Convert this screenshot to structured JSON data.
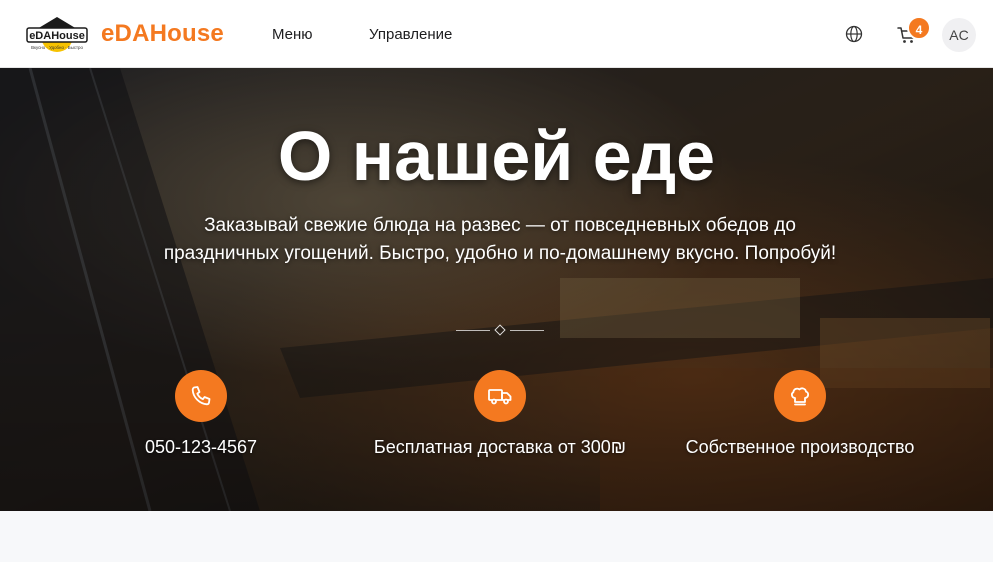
{
  "header": {
    "brand": "eDAHouse",
    "logo_text": "eDAHouse",
    "logo_tagline": "Вкусно · Удобно · Быстро",
    "nav": [
      {
        "label": "Меню"
      },
      {
        "label": "Управление"
      }
    ],
    "language_icon": "globe-icon",
    "cart_icon": "cart-icon",
    "cart_count": "4",
    "avatar_initials": "AC"
  },
  "hero": {
    "title": "О нашей еде",
    "subtitle": "Заказывай свежие блюда на развес — от повседневных обедов до праздничных угощений. Быстро, удобно и по-домашнему вкусно. Попробуй!",
    "features": [
      {
        "icon": "phone-icon",
        "label": "050-123-4567"
      },
      {
        "icon": "truck-icon",
        "label": "Бесплатная доставка от 300₪"
      },
      {
        "icon": "chef-hat-icon",
        "label": "Собственное производство"
      }
    ]
  },
  "colors": {
    "accent": "#f47920",
    "header_bg": "#ffffff",
    "text_dark": "#1d1d1f"
  }
}
